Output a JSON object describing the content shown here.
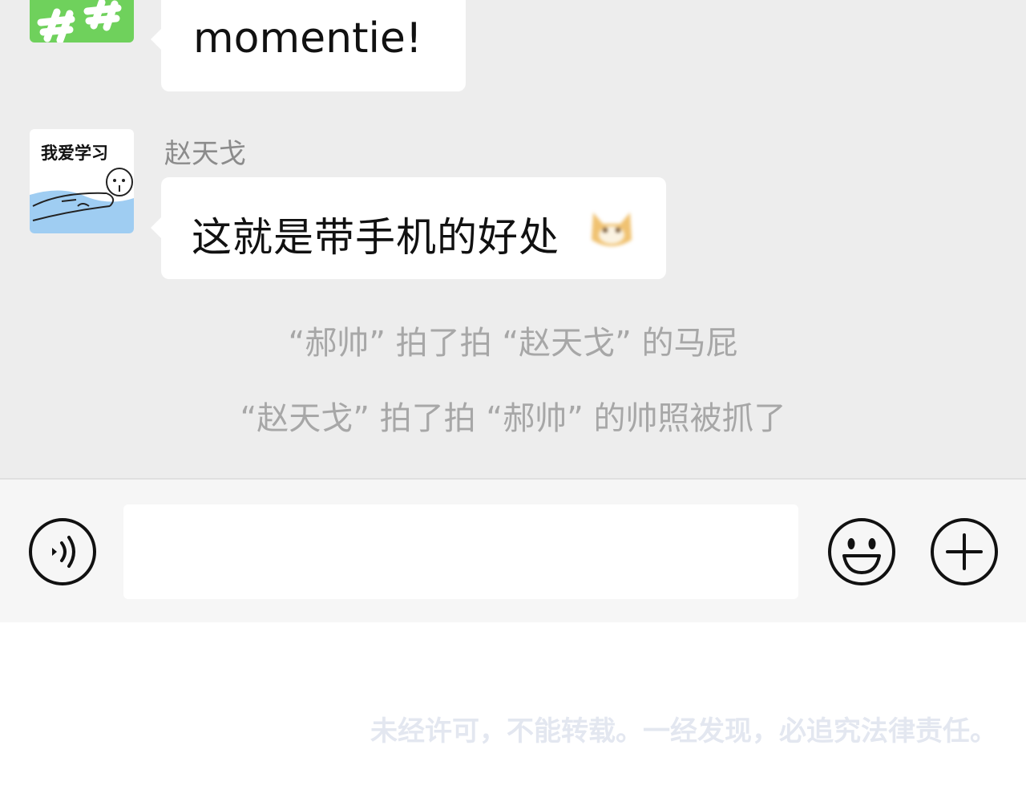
{
  "chat": {
    "messages": [
      {
        "text": "momentie!"
      },
      {
        "sender": "赵天戈",
        "avatar_text": "我爱学习",
        "text": "这就是带手机的好处"
      }
    ],
    "system_messages": [
      "“郝帅” 拍了拍 “赵天戈” 的马屁",
      "“赵天戈” 拍了拍 “郝帅” 的帅照被抓了"
    ]
  },
  "input_bar": {
    "voice_icon": "voice-icon",
    "text_value": "",
    "emoji_icon": "smiley-icon",
    "more_icon": "plus-icon"
  },
  "watermark": "未经许可，不能转载。一经发现，必追究法律责任。",
  "colors": {
    "chat_background": "#ededed",
    "bubble": "#ffffff",
    "system_text": "#a7a7a7",
    "avatar_green": "#6fd15c"
  }
}
